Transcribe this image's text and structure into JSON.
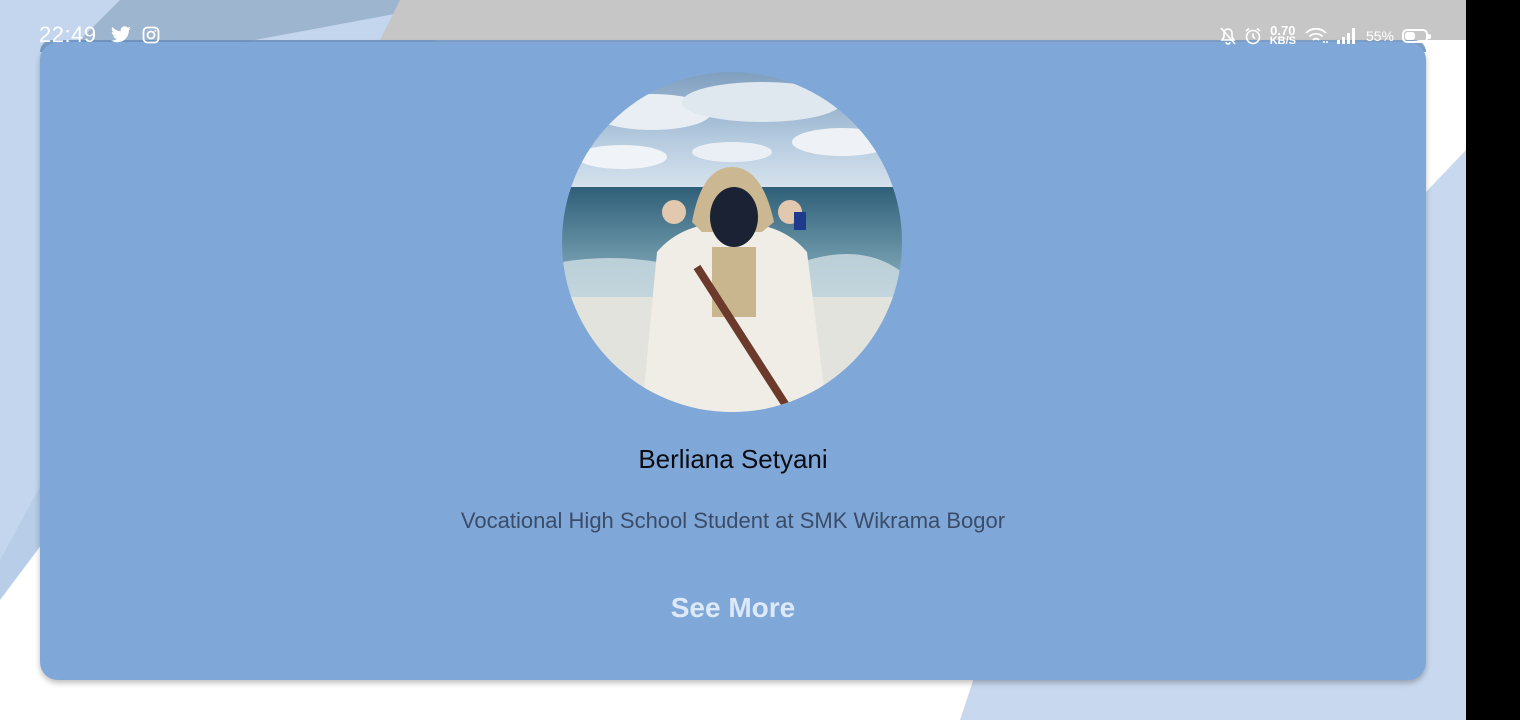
{
  "status_bar": {
    "time": "22:49",
    "net_speed_value": "0.70",
    "net_speed_unit": "KB/S",
    "battery": "55%",
    "battery_level": 0.55,
    "icons": [
      "twitter-icon",
      "instagram-icon",
      "bell-off-icon",
      "alarm-icon",
      "wifi-icon",
      "signal-icon",
      "battery-icon"
    ]
  },
  "profile": {
    "name": "Berliana Setyani",
    "subtitle": "Vocational High School Student at SMK Wikrama Bogor",
    "avatar_description": "person-in-hood-at-beach"
  },
  "actions": {
    "see_more_label": "See More"
  },
  "colors": {
    "card": "#7fa8d8",
    "background_shape": "#c4d6ee",
    "button_text": "#dde9f7"
  }
}
